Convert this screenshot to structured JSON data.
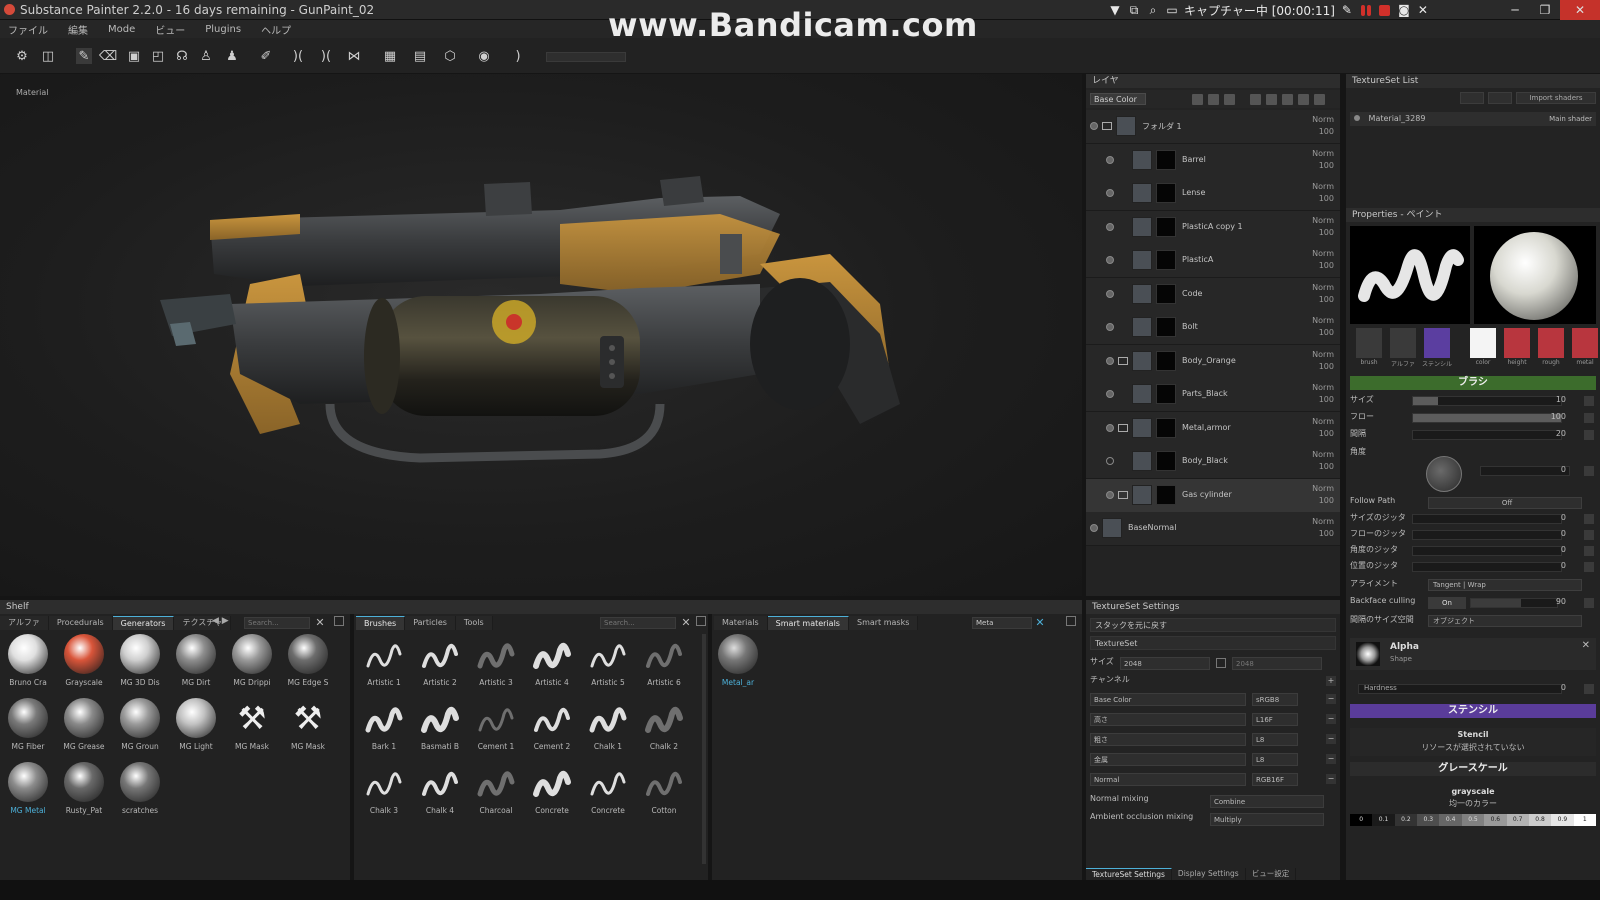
{
  "window": {
    "title": "Substance Painter 2.2.0 - 16 days remaining - GunPaint_02",
    "watermark": "www.Bandicam.com",
    "recording_text": "キャプチャー中 [00:00:11]"
  },
  "menu": [
    "ファイル",
    "編集",
    "Mode",
    "ビュー",
    "Plugins",
    "ヘルプ"
  ],
  "viewport": {
    "label": "Material"
  },
  "layers": {
    "panel_title": "レイヤ",
    "channel_select": "Base Color",
    "items": [
      {
        "name": "フォルダ 1",
        "blend": "Norm",
        "opacity": "100",
        "type": "folder",
        "visible": true,
        "indent": 0
      },
      {
        "name": "Barrel",
        "blend": "Norm",
        "opacity": "100",
        "type": "fill",
        "visible": true,
        "indent": 1
      },
      {
        "name": "Lense",
        "blend": "Norm",
        "opacity": "100",
        "type": "fill",
        "visible": true,
        "indent": 1
      },
      {
        "name": "PlasticA copy 1",
        "blend": "Norm",
        "opacity": "100",
        "type": "fill",
        "visible": true,
        "indent": 1
      },
      {
        "name": "PlasticA",
        "blend": "Norm",
        "opacity": "100",
        "type": "fill",
        "visible": true,
        "indent": 1
      },
      {
        "name": "Code",
        "blend": "Norm",
        "opacity": "100",
        "type": "fill",
        "visible": true,
        "indent": 1
      },
      {
        "name": "Bolt",
        "blend": "Norm",
        "opacity": "100",
        "type": "fill",
        "visible": true,
        "indent": 1
      },
      {
        "name": "Body_Orange",
        "blend": "Norm",
        "opacity": "100",
        "type": "folder",
        "visible": true,
        "indent": 1
      },
      {
        "name": "Parts_Black",
        "blend": "Norm",
        "opacity": "100",
        "type": "fill",
        "visible": true,
        "indent": 1
      },
      {
        "name": "Metal,armor",
        "blend": "Norm",
        "opacity": "100",
        "type": "folder",
        "visible": true,
        "indent": 1
      },
      {
        "name": "Body_Black",
        "blend": "Norm",
        "opacity": "100",
        "type": "fill",
        "visible": false,
        "indent": 1
      },
      {
        "name": "Gas cylinder",
        "blend": "Norm",
        "opacity": "100",
        "type": "folder",
        "visible": true,
        "indent": 1,
        "selected": true
      },
      {
        "name": "BaseNormal",
        "blend": "Norm",
        "opacity": "100",
        "type": "fill",
        "visible": true,
        "indent": 0
      }
    ]
  },
  "textureset_list": {
    "title": "TextureSet List",
    "import_label": "Import shaders",
    "row_label": "Material_3289",
    "shader_label": "Main shader"
  },
  "properties": {
    "title": "Properties - ペイント",
    "channels": [
      "brush",
      "アルファ",
      "ステンシル",
      "color",
      "height",
      "rough",
      "metal"
    ],
    "brush_header": "ブラシ",
    "rows": [
      {
        "label": "サイズ",
        "value": "10",
        "fill": 0.17
      },
      {
        "label": "フロー",
        "value": "100",
        "fill": 1.0
      },
      {
        "label": "間隔",
        "value": "20",
        "fill": 0.0
      }
    ],
    "angle_label": "角度",
    "angle_value": "0",
    "follow_path_label": "Follow Path",
    "follow_path_value": "Off",
    "jitter_rows": [
      {
        "label": "サイズのジッタ",
        "value": "0"
      },
      {
        "label": "フローのジッタ",
        "value": "0"
      },
      {
        "label": "角度のジッタ",
        "value": "0"
      },
      {
        "label": "位置のジッタ",
        "value": "0"
      }
    ],
    "alignment_label": "アライメント",
    "alignment_value": "Tangent | Wrap",
    "backface_label": "Backface culling",
    "backface_state": "On",
    "backface_value": "90",
    "size_space_label": "間隔のサイズ空間",
    "size_space_value": "オブジェクト",
    "alpha_label": "Alpha",
    "alpha_sub": "Shape",
    "hardness_label": "Hardness",
    "hardness_value": "0",
    "stencil_header": "ステンシル",
    "stencil_title": "Stencil",
    "stencil_msg": "リソースが選択されていない",
    "gray_header": "グレースケール",
    "gray_title": "grayscale",
    "gray_sub": "均一のカラー",
    "gray_ramp": [
      "0",
      "0.1",
      "0.2",
      "0.3",
      "0.4",
      "0.5",
      "0.6",
      "0.7",
      "0.8",
      "0.9",
      "1"
    ]
  },
  "shelf": {
    "title": "Shelf",
    "tabs": [
      "アルファ",
      "Procedurals",
      "Generators",
      "テクスチャ"
    ],
    "active_tab": "Generators",
    "search_placeholder": "Search...",
    "generators": [
      {
        "name": "Bruno Cra",
        "color": "#e0e0e0"
      },
      {
        "name": "Grayscale",
        "color": "#d9553a"
      },
      {
        "name": "MG 3D Dis",
        "color": "#cfcfcf"
      },
      {
        "name": "MG Dirt",
        "color": "#8e8e8e"
      },
      {
        "name": "MG Drippi",
        "color": "#9a9a9a"
      },
      {
        "name": "MG Edge S",
        "color": "#6d6d6d"
      },
      {
        "name": "MG Fiber",
        "color": "#7a7a7a"
      },
      {
        "name": "MG Grease",
        "color": "#8a8a8a"
      },
      {
        "name": "MG Groun",
        "color": "#9a9a9a"
      },
      {
        "name": "MG Light",
        "color": "#c2c2c2"
      },
      {
        "name": "MG Mask",
        "color": "icon"
      },
      {
        "name": "MG Mask",
        "color": "icon"
      },
      {
        "name": "MG Metal",
        "color": "#8c8c8c",
        "selected": true
      },
      {
        "name": "Rusty_Pat",
        "color": "#6a6a6a"
      },
      {
        "name": "scratches",
        "color": "#777777"
      }
    ],
    "brush_tabs": [
      "Brushes",
      "Particles",
      "Tools"
    ],
    "brush_search_placeholder": "Search...",
    "brushes": [
      "Artistic 1",
      "Artistic 2",
      "Artistic 3",
      "Artistic 4",
      "Artistic 5",
      "Artistic 6",
      "Bark 1",
      "Basmati B",
      "Cement 1",
      "Cement 2",
      "Chalk 1",
      "Chalk 2",
      "Chalk 3",
      "Chalk 4",
      "Charcoal",
      "Concrete",
      "Concrete",
      "Cotton"
    ],
    "material_tabs": [
      "Materials",
      "Smart materials",
      "Smart masks"
    ],
    "active_material_tab": "Smart materials",
    "material_search_value": "Meta",
    "materials": [
      {
        "name": "Metal_ar",
        "selected": true
      }
    ]
  },
  "textureset_settings": {
    "title": "TextureSet Settings",
    "stack_btn": "スタックを元に戻す",
    "textureset_btn": "TextureSet",
    "size_label": "サイズ",
    "size_value": "2048",
    "size_value2": "2048",
    "channel_label": "チャンネル",
    "channels": [
      {
        "name": "Base Color",
        "format": "sRGB8"
      },
      {
        "name": "高さ",
        "format": "L16F"
      },
      {
        "name": "粗さ",
        "format": "L8"
      },
      {
        "name": "金属",
        "format": "L8"
      },
      {
        "name": "Normal",
        "format": "RGB16F"
      }
    ],
    "normal_mixing_label": "Normal mixing",
    "normal_mixing_value": "Combine",
    "ao_mixing_label": "Ambient occlusion mixing",
    "ao_mixing_value": "Multiply",
    "bottom_tabs": [
      "TextureSet Settings",
      "Display Settings",
      "ビュー設定"
    ]
  }
}
